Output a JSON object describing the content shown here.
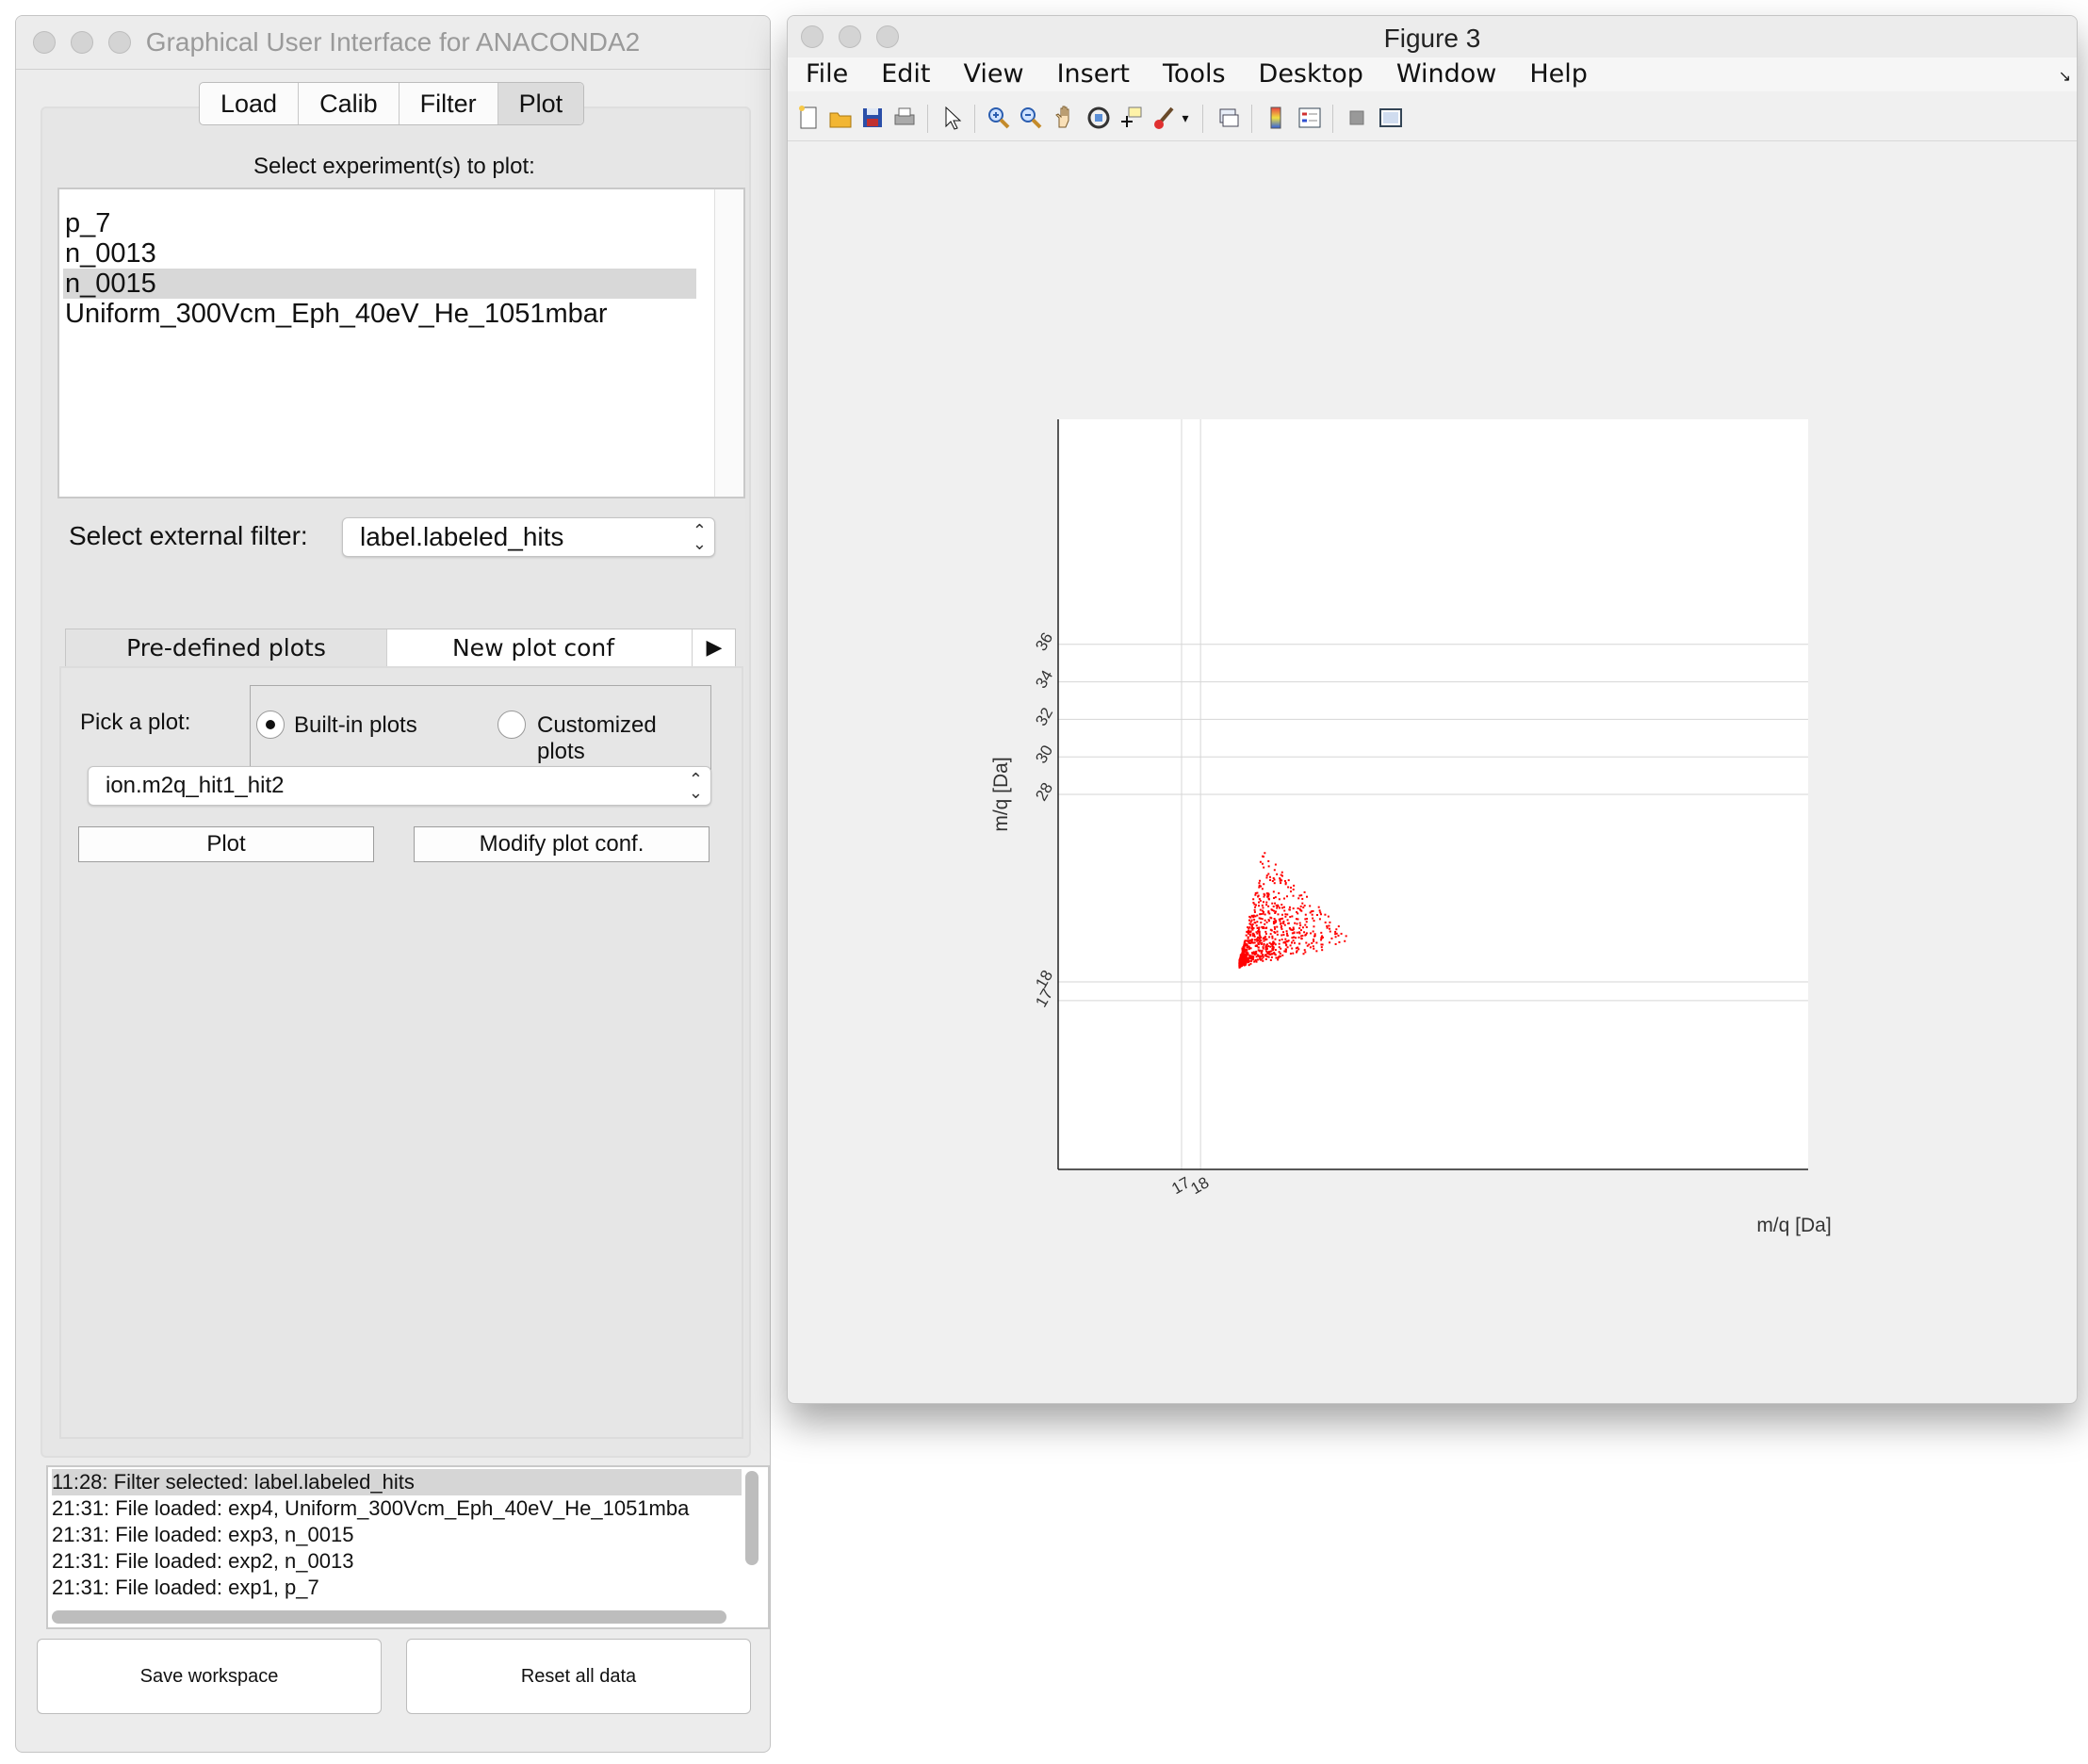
{
  "gui_window": {
    "title": "Graphical User Interface for ANACONDA2",
    "tabs": [
      "Load",
      "Calib",
      "Filter",
      "Plot"
    ],
    "selected_tab": "Plot",
    "experiments_label": "Select experiment(s) to plot:",
    "experiments": [
      "p_7",
      "n_0013",
      "n_0015",
      "Uniform_300Vcm_Eph_40eV_He_1051mbar"
    ],
    "selected_experiment": "n_0015",
    "external_filter_label": "Select external filter:",
    "external_filter_value": "label.labeled_hits",
    "subtabs": [
      "Pre-defined plots",
      "New plot conf"
    ],
    "subtab_more": "▶",
    "pick_plot_label": "Pick a plot:",
    "radio_builtin": "Built-in plots",
    "radio_custom": "Customized plots",
    "radio_selected": "Built-in plots",
    "plot_select_value": "ion.m2q_hit1_hit2",
    "plot_button": "Plot",
    "modify_button": "Modify plot conf.",
    "log": [
      "11:28: Filter selected: label.labeled_hits",
      "21:31: File loaded: exp4, Uniform_300Vcm_Eph_40eV_He_1051mba",
      "21:31: File loaded: exp3, n_0015",
      "21:31: File loaded: exp2, n_0013",
      "21:31: File loaded: exp1, p_7"
    ],
    "save_button": "Save workspace",
    "reset_button": "Reset all data"
  },
  "figure_window": {
    "title": "Figure 3",
    "menus": [
      "File",
      "Edit",
      "View",
      "Insert",
      "Tools",
      "Desktop",
      "Window",
      "Help"
    ],
    "toolbar_icons": [
      "new-figure-icon",
      "open-file-icon",
      "save-icon",
      "print-icon",
      "pointer-icon",
      "zoom-in-icon",
      "zoom-out-icon",
      "pan-hand-icon",
      "rotate-3d-icon",
      "data-cursor-icon",
      "brush-icon",
      "brush-dropdown-icon",
      "link-plot-icon",
      "colorbar-icon",
      "legend-icon",
      "hide-plot-tools-icon",
      "show-plot-tools-icon"
    ]
  },
  "chart_data": {
    "type": "scatter",
    "xlabel": "m/q [Da]",
    "ylabel": "m/q [Da]",
    "x_tick_labels": [
      "17",
      "18"
    ],
    "y_tick_labels": [
      "17",
      "18",
      "28",
      "30",
      "32",
      "34",
      "36"
    ],
    "series_color": "#ff0000",
    "note_points": "triangular cluster of hits between the y lines near 18 and 28"
  }
}
